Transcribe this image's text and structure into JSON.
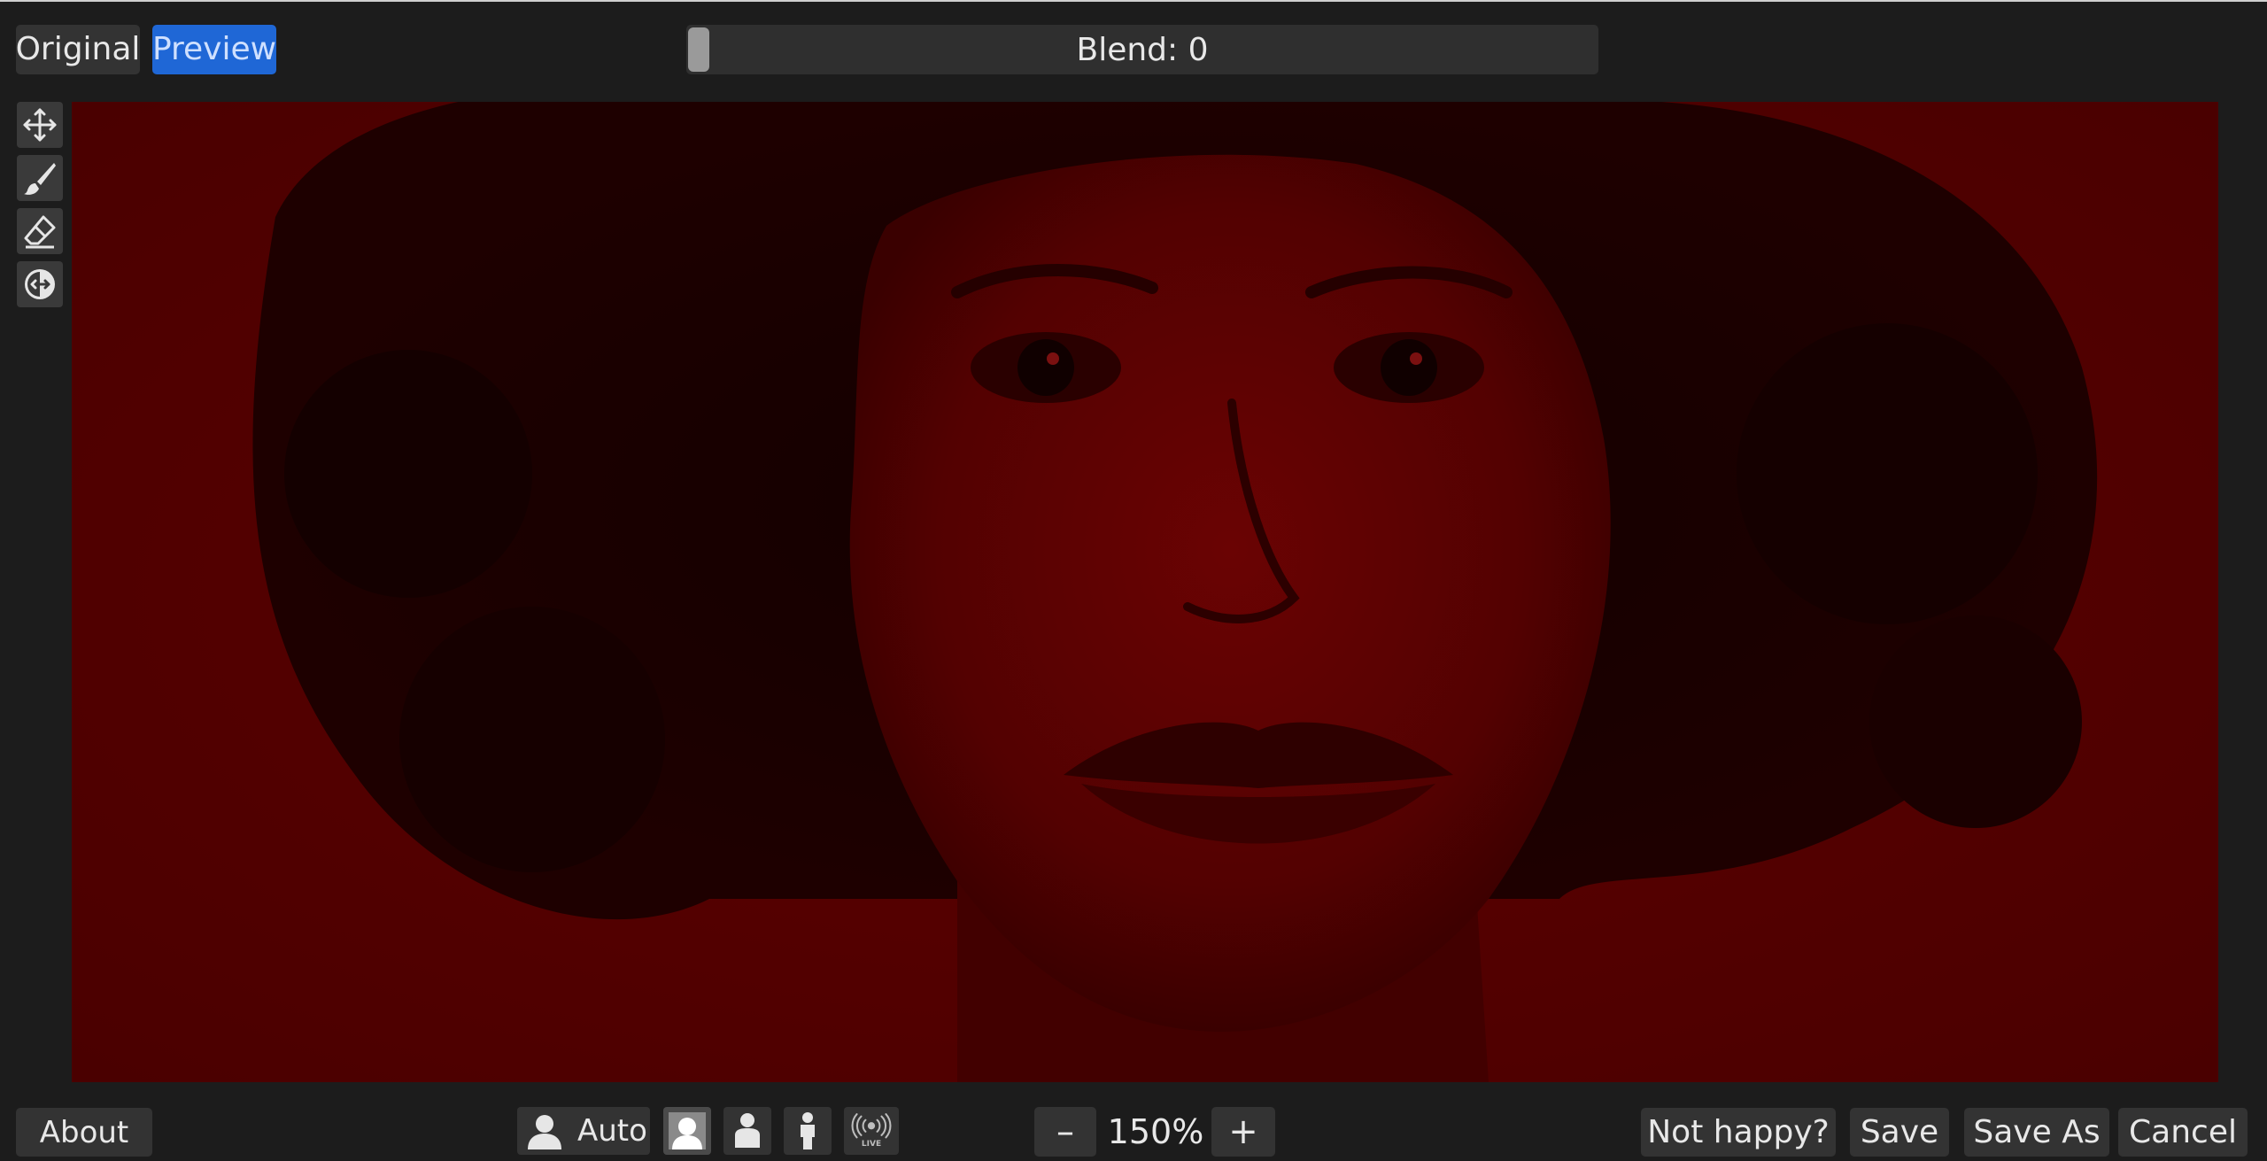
{
  "view_modes": {
    "original": "Original",
    "preview": "Preview",
    "active": "Preview"
  },
  "blend": {
    "label": "Blend: 0",
    "value": 0
  },
  "tools": [
    {
      "name": "move",
      "icon": "move-arrows-icon"
    },
    {
      "name": "brush",
      "icon": "brush-icon"
    },
    {
      "name": "eraser",
      "icon": "eraser-icon"
    },
    {
      "name": "reset",
      "icon": "reset-circle-icon"
    }
  ],
  "canvas": {
    "tint_color": "#5a0000",
    "subject": "portrait-photo"
  },
  "bottom": {
    "about_label": "About",
    "detect_auto_label": "Auto",
    "zoom_minus": "–",
    "zoom_value": "150%",
    "zoom_plus": "+",
    "not_happy_label": "Not happy?",
    "save_label": "Save",
    "save_as_label": "Save As",
    "cancel_label": "Cancel",
    "live_label": "LIVE"
  },
  "colors": {
    "background": "#1c1c1c",
    "button": "#333333",
    "accent": "#1f67d6",
    "text": "#e8e8e8"
  }
}
